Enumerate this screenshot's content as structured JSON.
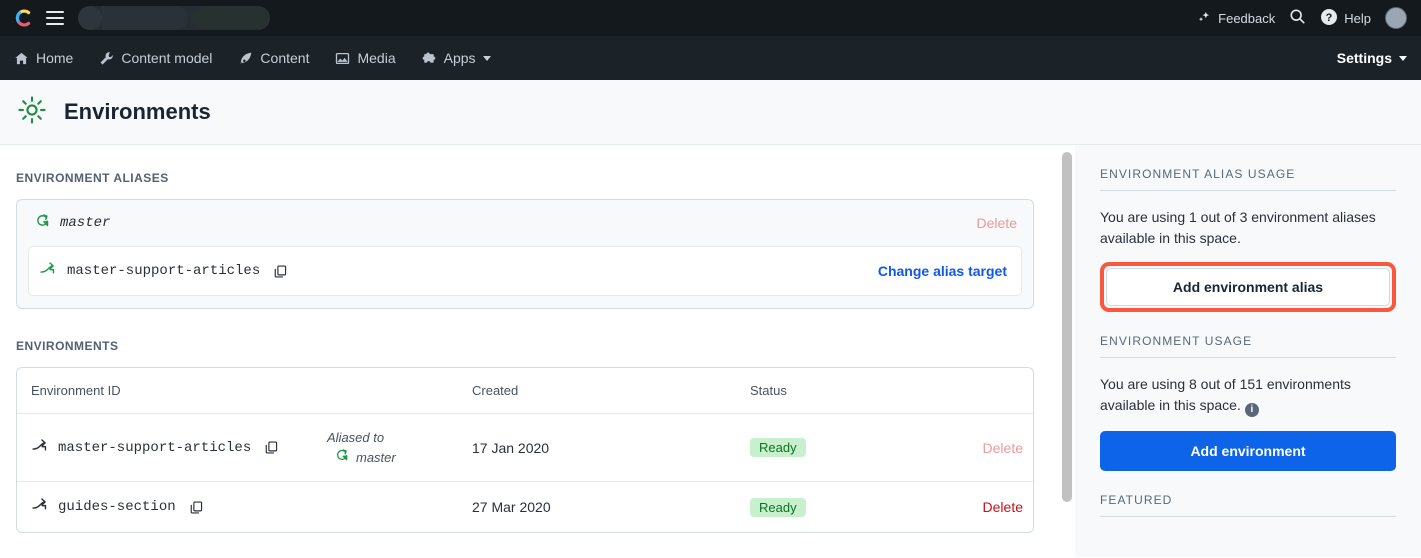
{
  "topbar": {
    "logo": "contentful-logo-icon",
    "menu_icon": "hamburger-icon",
    "feedback_label": "Feedback",
    "feedback_icon": "sparkle-icon",
    "search_icon": "search-icon",
    "help_label": "Help",
    "help_icon": "question-circle-icon",
    "avatar": "user-avatar"
  },
  "nav": {
    "items": [
      {
        "label": "Home",
        "icon": "home-icon"
      },
      {
        "label": "Content model",
        "icon": "wrench-icon"
      },
      {
        "label": "Content",
        "icon": "pen-nib-icon"
      },
      {
        "label": "Media",
        "icon": "image-icon"
      },
      {
        "label": "Apps",
        "icon": "puzzle-piece-icon",
        "caret": true
      }
    ],
    "settings_label": "Settings"
  },
  "page": {
    "title": "Environments",
    "title_icon": "gear-icon"
  },
  "aliases_section": {
    "label": "Environment aliases",
    "alias": {
      "icon": "alias-icon",
      "name": "master",
      "delete_label": "Delete",
      "target_icon": "environment-icon",
      "target_name": "master-support-articles",
      "copy_icon": "copy-icon",
      "change_label": "Change alias target"
    }
  },
  "environments_section": {
    "label": "Environments",
    "columns": [
      "Environment ID",
      "",
      "Created",
      "Status",
      ""
    ],
    "rows": [
      {
        "icon": "environment-icon",
        "id": "master-support-articles",
        "copy_icon": "copy-icon",
        "aliased_label": "Aliased to",
        "aliased_icon": "alias-icon",
        "aliased_name": "master",
        "created": "17 Jan 2020",
        "status": "Ready",
        "delete_label": "Delete",
        "delete_state": "muted"
      },
      {
        "icon": "environment-icon",
        "id": "guides-section",
        "copy_icon": "copy-icon",
        "aliased_label": "",
        "aliased_icon": "",
        "aliased_name": "",
        "created": "27 Mar 2020",
        "status": "Ready",
        "delete_label": "Delete",
        "delete_state": "strong"
      }
    ]
  },
  "sidebar": {
    "alias_usage": {
      "label": "Environment alias usage",
      "text": "You are using 1 out of 3 environment aliases available in this space.",
      "button_label": "Add environment alias",
      "highlight_color": "#f9583f"
    },
    "env_usage": {
      "label": "Environment usage",
      "text": "You are using 8 out of 151 environments available in this space.",
      "info_icon": "info-icon",
      "button_label": "Add environment",
      "button_color": "#0d64e8"
    },
    "featured": {
      "label": "Featured"
    }
  }
}
